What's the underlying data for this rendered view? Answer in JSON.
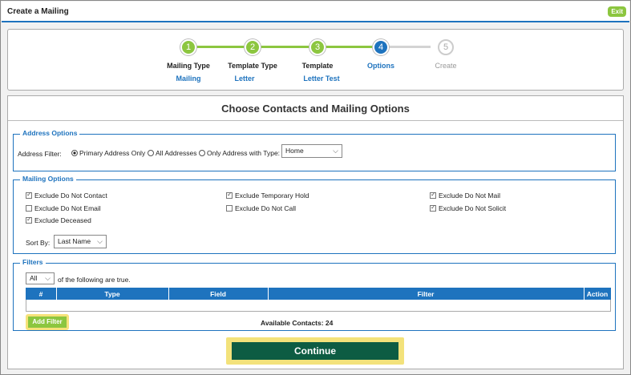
{
  "window": {
    "title": "Create a Mailing",
    "exit_label": "Exit"
  },
  "steps": [
    {
      "number": "1",
      "label": "Mailing Type",
      "value": "Mailing",
      "state": "done"
    },
    {
      "number": "2",
      "label": "Template Type",
      "value": "Letter",
      "state": "done"
    },
    {
      "number": "3",
      "label": "Template",
      "value": "Letter Test",
      "state": "done"
    },
    {
      "number": "4",
      "label": "Options",
      "value": "",
      "state": "current"
    },
    {
      "number": "5",
      "label": "Create",
      "value": "",
      "state": "todo"
    }
  ],
  "main": {
    "heading": "Choose Contacts and Mailing Options"
  },
  "address_options": {
    "legend": "Address Options",
    "filter_label": "Address Filter:",
    "radio_primary": "Primary Address Only",
    "radio_all": "All Addresses",
    "radio_type": "Only Address with Type:",
    "type_value": "Home"
  },
  "mailing_options": {
    "legend": "Mailing Options",
    "exclude_do_not_contact": "Exclude Do Not Contact",
    "exclude_temporary_hold": "Exclude Temporary Hold",
    "exclude_do_not_mail": "Exclude Do Not Mail",
    "exclude_do_not_email": "Exclude Do Not Email",
    "exclude_do_not_call": "Exclude Do Not Call",
    "exclude_do_not_solicit": "Exclude Do Not Solicit",
    "exclude_deceased": "Exclude Deceased",
    "sort_label": "Sort By:",
    "sort_value": "Last Name"
  },
  "filters": {
    "legend": "Filters",
    "match_value": "All",
    "match_suffix": "of the following are true.",
    "columns": {
      "num": "#",
      "type": "Type",
      "field": "Field",
      "filter": "Filter",
      "action": "Action"
    },
    "add_filter_label": "Add Filter",
    "available_contacts": "Available Contacts: 24"
  },
  "footer": {
    "continue_label": "Continue"
  }
}
